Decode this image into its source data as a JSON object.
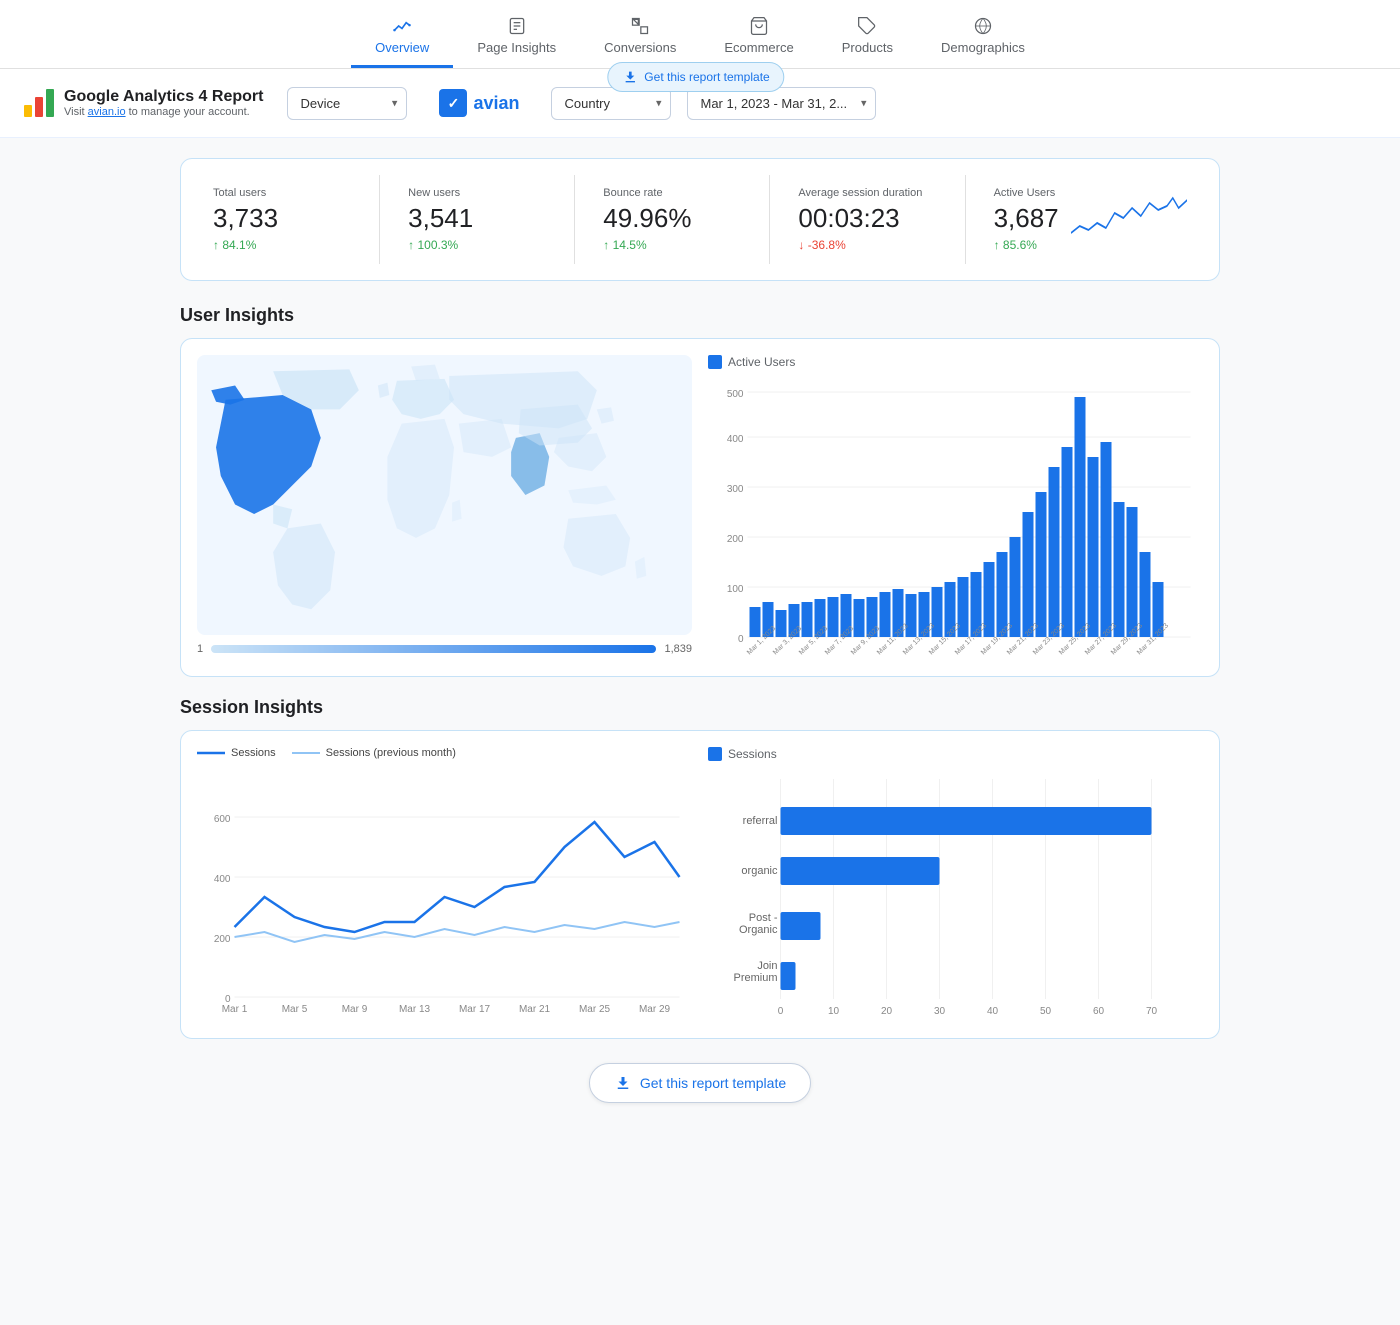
{
  "nav": {
    "items": [
      {
        "id": "overview",
        "label": "Overview",
        "active": true
      },
      {
        "id": "page-insights",
        "label": "Page Insights",
        "active": false
      },
      {
        "id": "conversions",
        "label": "Conversions",
        "active": false
      },
      {
        "id": "ecommerce",
        "label": "Ecommerce",
        "active": false
      },
      {
        "id": "products",
        "label": "Products",
        "active": false
      },
      {
        "id": "demographics",
        "label": "Demographics",
        "active": false
      }
    ]
  },
  "header": {
    "report_title": "Google Analytics 4 Report",
    "report_sub": "Visit avian.io to manage your account.",
    "avian_link": "avian.io",
    "get_template_label": "Get this report template",
    "device_label": "Device",
    "country_label": "Country",
    "date_range": "Mar 1, 2023 - Mar 31, 2..."
  },
  "metrics": [
    {
      "label": "Total users",
      "value": "3,733",
      "change": "↑ 84.1%",
      "up": true
    },
    {
      "label": "New users",
      "value": "3,541",
      "change": "↑ 100.3%",
      "up": true
    },
    {
      "label": "Bounce rate",
      "value": "49.96%",
      "change": "↑ 14.5%",
      "up": true
    },
    {
      "label": "Average session duration",
      "value": "00:03:23",
      "change": "↓ -36.8%",
      "up": false
    },
    {
      "label": "Active Users",
      "value": "3,687",
      "change": "↑ 85.6%",
      "up": true
    }
  ],
  "user_insights_title": "User Insights",
  "session_insights_title": "Session Insights",
  "map": {
    "legend_min": "1",
    "legend_max": "1,839"
  },
  "active_users_chart": {
    "legend_label": "Active Users",
    "y_labels": [
      "0",
      "100",
      "200",
      "300",
      "400",
      "500"
    ],
    "bars": [
      60,
      70,
      55,
      65,
      70,
      75,
      80,
      85,
      75,
      80,
      90,
      95,
      85,
      90,
      100,
      110,
      120,
      130,
      150,
      170,
      200,
      250,
      290,
      340,
      380,
      480,
      360,
      390,
      270,
      260,
      170,
      110
    ]
  },
  "session_chart": {
    "legend_sessions": "Sessions",
    "legend_prev": "Sessions (previous month)",
    "y_labels": [
      "0",
      "200",
      "400",
      "600"
    ],
    "x_labels": [
      "Mar 1",
      "Mar 5",
      "Mar 9",
      "Mar 13",
      "Mar 17",
      "Mar 21",
      "Mar 25",
      "Mar 29"
    ]
  },
  "sessions_by_source": {
    "legend_label": "Sessions",
    "channels": [
      {
        "label": "referral",
        "value": 70,
        "max": 70
      },
      {
        "label": "organic",
        "value": 27,
        "max": 70
      },
      {
        "label": "Post -\nOrganic",
        "value": 8,
        "max": 70
      },
      {
        "label": "Join\nPremium",
        "value": 3,
        "max": 70
      }
    ],
    "x_labels": [
      "0",
      "10",
      "20",
      "30",
      "40",
      "50",
      "60",
      "70"
    ]
  },
  "get_template_bottom": "Get this report template"
}
